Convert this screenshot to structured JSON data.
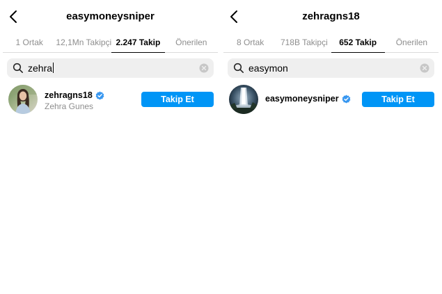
{
  "colors": {
    "accent": "#0095f6",
    "verified": "#3897f0",
    "muted": "#8e8e8e",
    "search_bg": "#efefef"
  },
  "left": {
    "title": "easymoneysniper",
    "tabs": [
      {
        "label": "1 Ortak"
      },
      {
        "label": "12,1Mn Takipçi"
      },
      {
        "label": "2.247 Takip",
        "active": true
      },
      {
        "label": "Önerilen"
      }
    ],
    "search": {
      "value": "zehra"
    },
    "result": {
      "username": "zehragns18",
      "fullname": "Zehra Gunes",
      "verified": true,
      "button": "Takip Et"
    }
  },
  "right": {
    "title": "zehragns18",
    "tabs": [
      {
        "label": "8 Ortak"
      },
      {
        "label": "718B Takipçi"
      },
      {
        "label": "652 Takip",
        "active": true
      },
      {
        "label": "Önerilen"
      }
    ],
    "search": {
      "value": "easymon"
    },
    "result": {
      "username": "easymoneysniper",
      "verified": true,
      "button": "Takip Et"
    }
  }
}
